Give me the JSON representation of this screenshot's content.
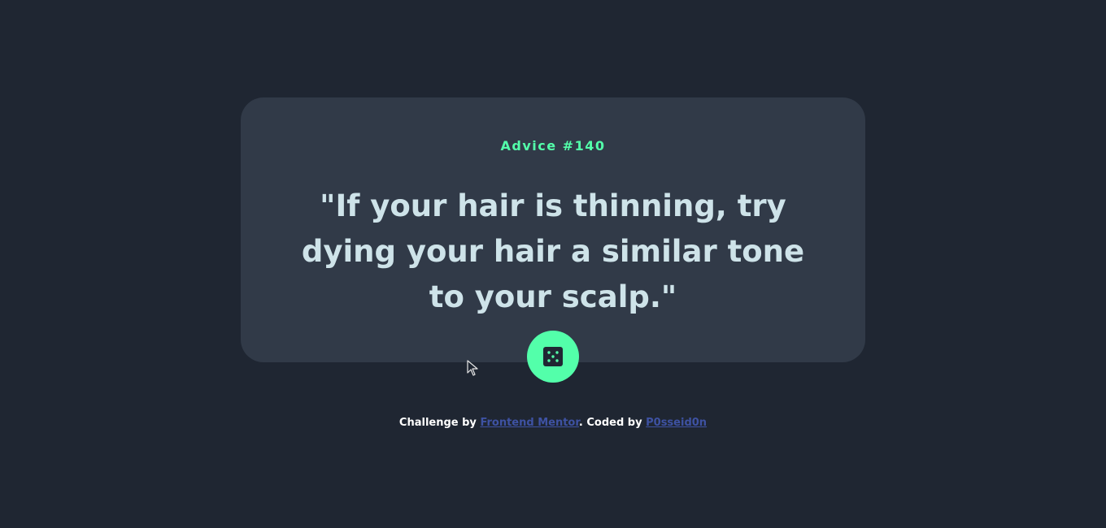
{
  "card": {
    "advice_id": "Advice #140",
    "quote": "\"If your hair is thinning, try dying your hair a similar tone to your scalp.\""
  },
  "dice_button": {
    "icon": "dice-icon"
  },
  "footer": {
    "prefix": "Challenge by ",
    "link1": "Frontend Mentor",
    "middle": ". Coded by ",
    "link2": "P0sseid0n"
  },
  "colors": {
    "background": "#1f2632",
    "card": "#313a48",
    "accent": "#53ffaa",
    "quote_text": "#cee3e9",
    "link": "#3e52a3"
  }
}
